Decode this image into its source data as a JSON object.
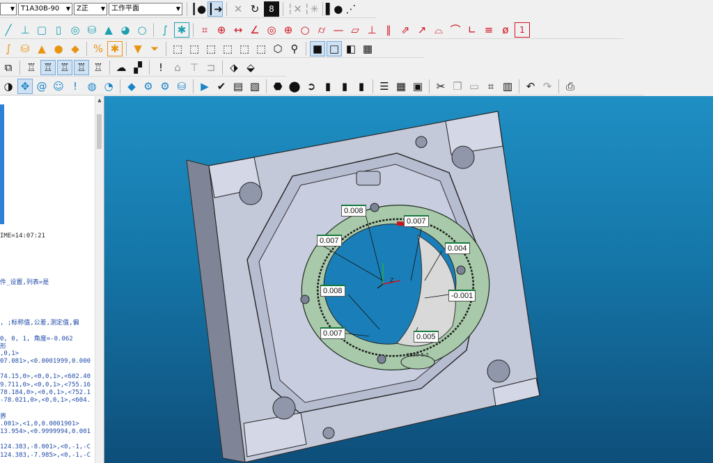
{
  "toolbar": {
    "combo_probe": "T1A30B-90",
    "combo_view": "Z正",
    "combo_plane": "工作平面"
  },
  "left_panel": {
    "lines": [
      "IME=14:07:21",
      "件_设置,列表=是",
      ", ;标称值,公差,测定值,偏",
      "0, 0, 1, 角度=-0.062",
      "形",
      ",0,1>",
      "07.081>,<0.0001999,0.000",
      "74.15,0>,<0,0,1>,<602.40",
      "9.711,0>,<0,0,1>,<755.16",
      "78.184,0>,<0,0,1>,<752.1",
      "-78.021,0>,<0,0,1>,<604.",
      "界",
      ".001>,<1,0,0.0001901>",
      "13.954>,<0.9999994,0.001",
      "124.383,-8.001>,<0,-1,-C",
      "124.383,-7.985>,<0,-1,-C"
    ]
  },
  "viewport": {
    "labels": [
      "0.008",
      "0.007",
      "0.007",
      "0.004",
      "0.008",
      "-0.001",
      "0.007",
      "0.005"
    ],
    "part_engraving": "1220-5-2",
    "axis_z": "Z"
  },
  "colors": {
    "viewport_top": "#1f8fc4",
    "viewport_bottom": "#0e4e7a",
    "plate": "#c4c9da",
    "ring": "#a8c9aa",
    "accent_red": "#d0101e"
  }
}
